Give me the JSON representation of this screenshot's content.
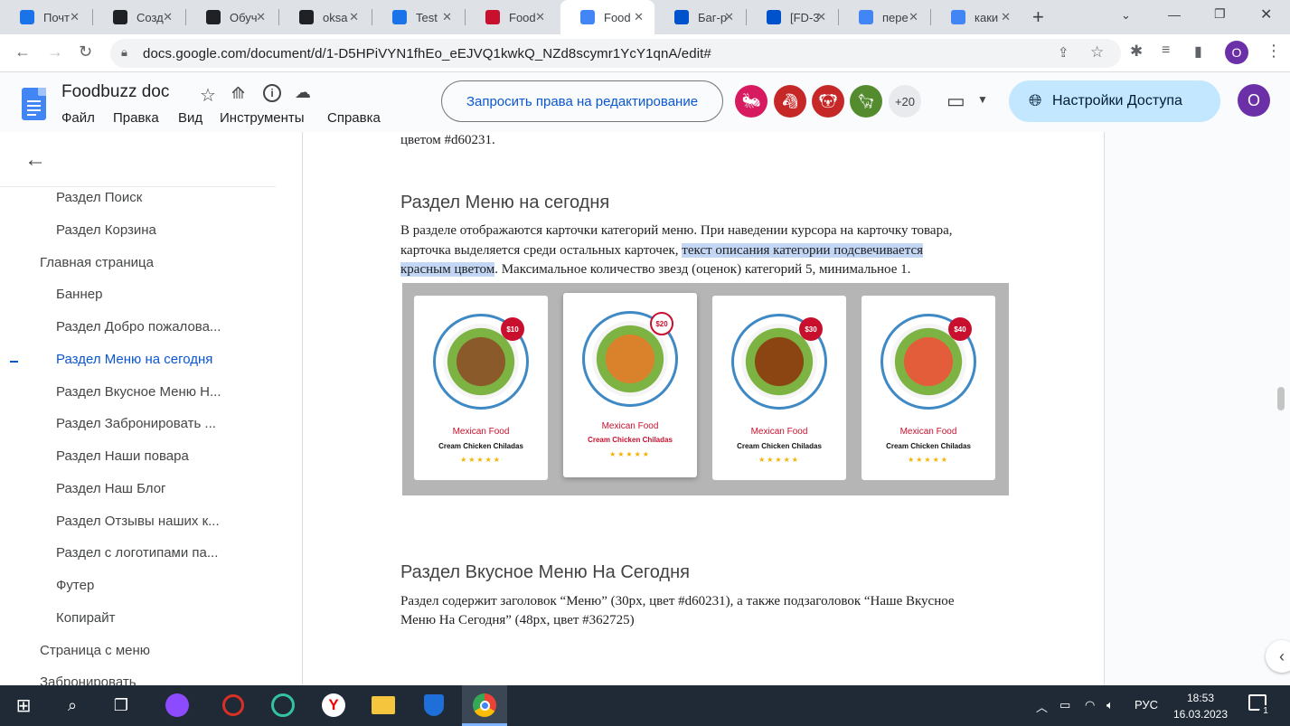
{
  "browser": {
    "tabs": [
      {
        "title": "Почт",
        "icon": "mail-icon",
        "color": "#1a73e8"
      },
      {
        "title": "Созд",
        "icon": "openai-icon",
        "color": "#202124"
      },
      {
        "title": "Обуч",
        "icon": "openai-icon",
        "color": "#202124"
      },
      {
        "title": "oksa",
        "icon": "github-icon",
        "color": "#202124"
      },
      {
        "title": "Test",
        "icon": "testrail-icon",
        "color": "#1a73e8"
      },
      {
        "title": "Food",
        "icon": "foodbuzz-icon",
        "color": "#c8102e"
      },
      {
        "title": "Food",
        "icon": "docs-icon",
        "color": "#4285f4",
        "active": true
      },
      {
        "title": "Баг-р",
        "icon": "jira-icon",
        "color": "#0052cc"
      },
      {
        "title": "[FD-3",
        "icon": "jira-icon",
        "color": "#0052cc"
      },
      {
        "title": "пере",
        "icon": "google-icon",
        "color": "#4285f4"
      },
      {
        "title": "каки",
        "icon": "google-icon",
        "color": "#4285f4"
      }
    ],
    "new_tab": "+",
    "url": "docs.google.com/document/d/1-D5HPiVYN1fhEo_eEJVQ1kwkQ_NZd8scymr1YcY1qnA/edit#",
    "profile_initial": "O"
  },
  "docs": {
    "title": "Foodbuzz doc",
    "menu": [
      "Файл",
      "Правка",
      "Вид",
      "Инструменты",
      "Справка"
    ],
    "request_edit": "Запросить права на редактирование",
    "collaborators_more": "+20",
    "share": "Настройки Доступа",
    "user_initial": "O"
  },
  "outline": [
    {
      "label": "Раздел Поиск",
      "level": 2
    },
    {
      "label": "Раздел Корзина",
      "level": 2
    },
    {
      "label": "Главная страница",
      "level": 1
    },
    {
      "label": "Баннер",
      "level": 2
    },
    {
      "label": "Раздел Добро пожалова...",
      "level": 2
    },
    {
      "label": "Раздел Меню на сегодня",
      "level": 2,
      "active": true
    },
    {
      "label": "Раздел Вкусное Меню Н...",
      "level": 2
    },
    {
      "label": "Раздел Забронировать ...",
      "level": 2
    },
    {
      "label": "Раздел Наши повара",
      "level": 2
    },
    {
      "label": "Раздел Наш Блог",
      "level": 2
    },
    {
      "label": "Раздел Отзывы наших к...",
      "level": 2
    },
    {
      "label": "Раздел с логотипами па...",
      "level": 2
    },
    {
      "label": "Футер",
      "level": 2
    },
    {
      "label": "Копирайт",
      "level": 2
    },
    {
      "label": "Страница с меню",
      "level": 1
    },
    {
      "label": "Забронировать",
      "level": 1
    }
  ],
  "content": {
    "prev_tail": "цветом #d60231.",
    "section1_heading": "Раздел Меню на сегодня",
    "section1_line1": "В разделе отображаются карточки категорий меню. При наведении курсора на карточку товара,",
    "section1_line2_a": "карточка выделяется среди остальных карточек, ",
    "section1_line2_hl": "текст описания категории подсвечивается",
    "section1_line3_hl": "красным цветом",
    "section1_line3_b": ". Максимальное количество звезд (оценок) категорий 5, минимальное 1.",
    "section2_heading": "Раздел Вкусное Меню На Сегодня",
    "section2_line1": "Раздел содержит заголовок “Меню” (30px, цвет #d60231), а также подзаголовок “Наше Вкусное",
    "section2_line2": "Меню На Сегодня” (48px, цвет #362725)"
  },
  "cards": [
    {
      "price": "$10",
      "category": "Mexican Food",
      "dish": "Cream Chicken Chiladas",
      "stars": "★★★★★",
      "food_color": "#8a5a2b",
      "highlighted": false
    },
    {
      "price": "$20",
      "category": "Mexican Food",
      "dish": "Cream Chicken Chiladas",
      "stars": "★★★★★",
      "food_color": "#d9822b",
      "highlighted": true
    },
    {
      "price": "$30",
      "category": "Mexican Food",
      "dish": "Cream Chicken Chiladas",
      "stars": "★★★★★",
      "food_color": "#8b4513",
      "highlighted": false
    },
    {
      "price": "$40",
      "category": "Mexican Food",
      "dish": "Cream Chicken Chiladas",
      "stars": "★★★★★",
      "food_color": "#e35d3a",
      "highlighted": false
    }
  ],
  "taskbar": {
    "language": "РУС",
    "time": "18:53",
    "date": "16.03.2023",
    "notifications": "1"
  }
}
